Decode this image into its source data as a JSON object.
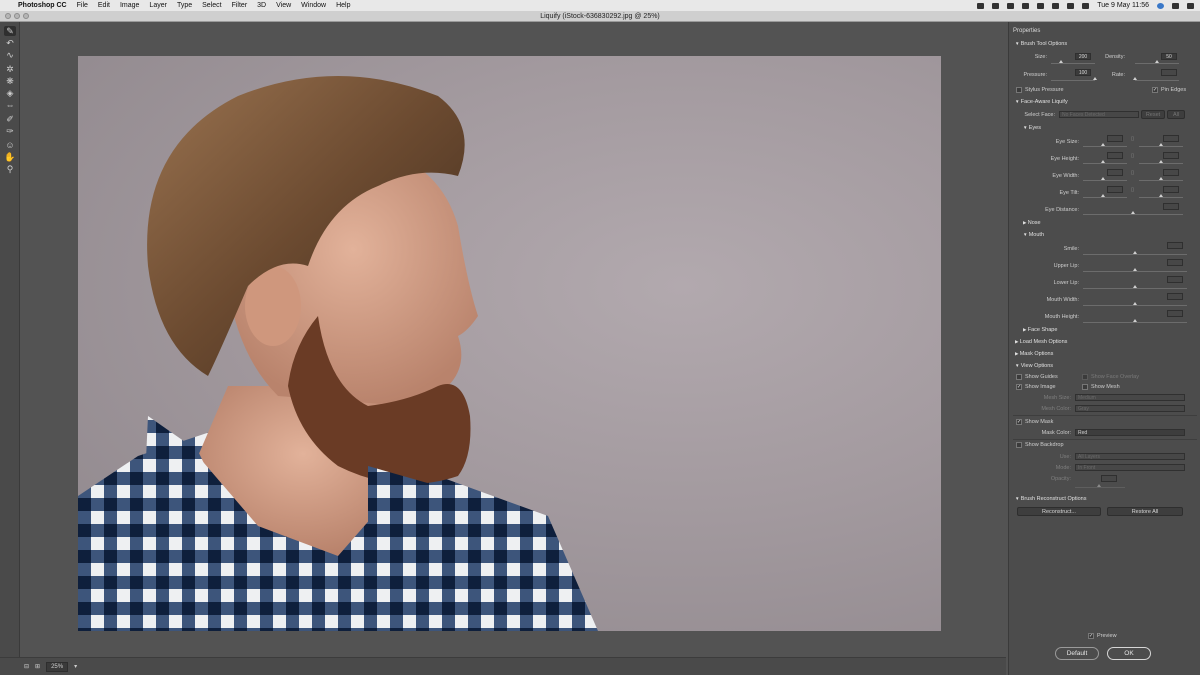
{
  "menubar": {
    "app": "Photoshop CC",
    "items": [
      "File",
      "Edit",
      "Image",
      "Layer",
      "Type",
      "Select",
      "Filter",
      "3D",
      "View",
      "Window",
      "Help"
    ],
    "clock": "Tue 9 May  11:56"
  },
  "window": {
    "title": "Liquify (iStock-636830292.jpg @ 25%)"
  },
  "status": {
    "zoom": "25%"
  },
  "panel": {
    "title": "Properties",
    "brush": {
      "section": "Brush Tool Options",
      "size_label": "Size:",
      "size_value": "200",
      "density_label": "Density:",
      "density_value": "50",
      "pressure_label": "Pressure:",
      "pressure_value": "100",
      "rate_label": "Rate:",
      "stylus_label": "Stylus Pressure",
      "pin_label": "Pin Edges"
    },
    "face": {
      "section": "Face-Aware Liquify",
      "select_label": "Select Face:",
      "select_value": "No Faces Detected",
      "reset": "Reset",
      "all": "All",
      "eyes": "Eyes",
      "eye_size": "Eye Size:",
      "eye_height": "Eye Height:",
      "eye_width": "Eye Width:",
      "eye_tilt": "Eye Tilt:",
      "eye_distance": "Eye Distance:",
      "nose": "Nose",
      "mouth": "Mouth",
      "smile": "Smile:",
      "upper_lip": "Upper Lip:",
      "lower_lip": "Lower Lip:",
      "mouth_width": "Mouth Width:",
      "mouth_height": "Mouth Height:",
      "face_shape": "Face Shape"
    },
    "load_mesh": "Load Mesh Options",
    "mask_options": "Mask Options",
    "view": {
      "section": "View Options",
      "show_guides": "Show Guides",
      "show_face_overlay": "Show Face Overlay",
      "show_image": "Show Image",
      "show_mesh": "Show Mesh",
      "mesh_size_label": "Mesh Size:",
      "mesh_size_value": "Medium",
      "mesh_color_label": "Mesh Color:",
      "mesh_color_value": "Gray",
      "show_mask": "Show Mask",
      "mask_color_label": "Mask Color:",
      "mask_color_value": "Red",
      "show_backdrop": "Show Backdrop",
      "use_label": "Use:",
      "use_value": "All Layers",
      "mode_label": "Mode:",
      "mode_value": "In Front",
      "opacity_label": "Opacity:"
    },
    "reconstruct": {
      "section": "Brush Reconstruct Options",
      "reconstruct": "Reconstruct...",
      "restore_all": "Restore All"
    },
    "preview": "Preview",
    "default": "Default",
    "ok": "OK"
  },
  "colors": {
    "panel_bg": "#4c4c4c",
    "canvas_bg": "#535353",
    "backdrop": "#a39a9f"
  }
}
